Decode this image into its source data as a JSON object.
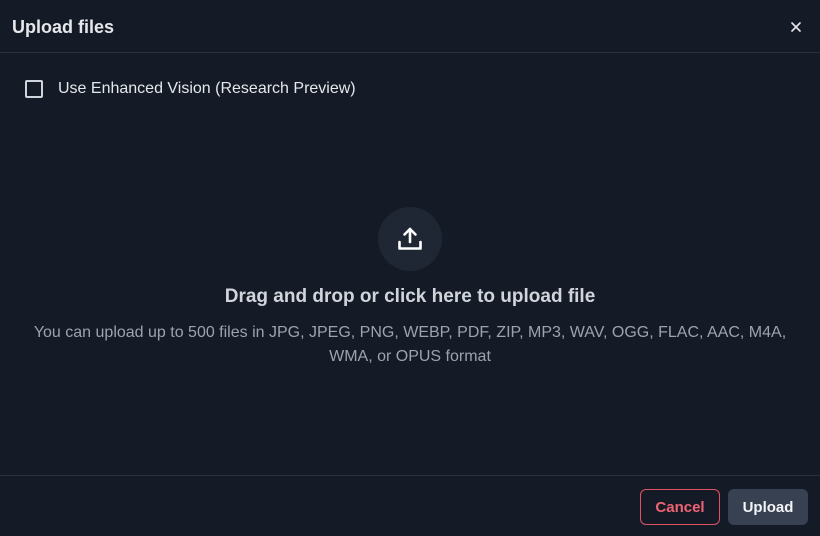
{
  "dialog": {
    "title": "Upload files",
    "close_icon": "close-icon"
  },
  "options": {
    "enhanced_vision_label": "Use Enhanced Vision (Research Preview)",
    "enhanced_vision_checked": false
  },
  "dropzone": {
    "icon": "upload-icon",
    "heading": "Drag and drop or click here to upload file",
    "subtext": "You can upload up to 500 files in JPG, JPEG, PNG, WEBP, PDF, ZIP, MP3, WAV, OGG, FLAC, AAC, M4A, WMA, or OPUS format"
  },
  "footer": {
    "cancel_label": "Cancel",
    "upload_label": "Upload"
  },
  "colors": {
    "background": "#141b26",
    "cancel_accent": "#e05262",
    "upload_button_bg": "#374151"
  }
}
